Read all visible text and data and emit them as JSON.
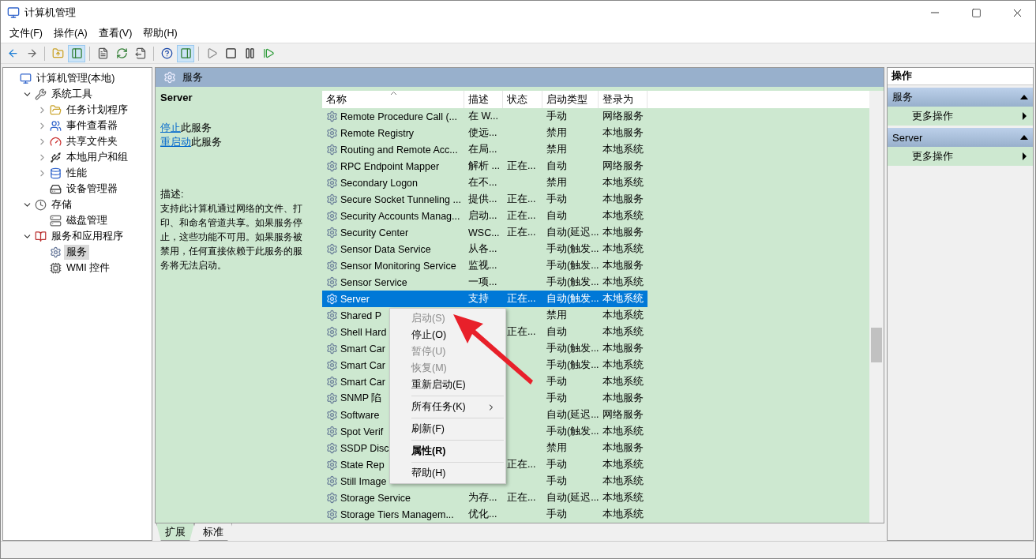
{
  "window": {
    "title": "计算机管理"
  },
  "menu_bar": [
    "文件(F)",
    "操作(A)",
    "查看(V)",
    "帮助(H)"
  ],
  "toolbar": [
    {
      "pressed": false
    },
    {
      "pressed": false
    },
    {
      "pressed": false
    },
    {
      "pressed": true
    },
    {
      "pressed": false
    },
    {
      "pressed": false
    },
    {
      "pressed": false
    },
    {
      "pressed": false
    },
    {
      "pressed": true
    },
    {
      "pressed": false
    },
    {
      "pressed": false
    },
    {
      "pressed": false
    },
    {
      "pressed": false
    }
  ],
  "tree": [
    {
      "label": "计算机管理(本地)",
      "selected": false,
      "children": [
        {
          "label": "系统工具",
          "selected": false,
          "expanded": true,
          "children": [
            {
              "label": "任务计划程序",
              "selected": false,
              "expanded": false
            },
            {
              "label": "事件查看器",
              "selected": false,
              "expanded": false
            },
            {
              "label": "共享文件夹",
              "selected": false,
              "expanded": false
            },
            {
              "label": "本地用户和组",
              "selected": false,
              "expanded": false
            },
            {
              "label": "性能",
              "selected": false,
              "expanded": false
            },
            {
              "label": "设备管理器",
              "selected": false
            }
          ]
        },
        {
          "label": "存储",
          "selected": false,
          "expanded": true,
          "children": [
            {
              "label": "磁盘管理",
              "selected": false
            }
          ]
        },
        {
          "label": "服务和应用程序",
          "selected": false,
          "expanded": true,
          "children": [
            {
              "label": "服务",
              "selected": true
            },
            {
              "label": "WMI 控件",
              "selected": false
            }
          ]
        }
      ]
    }
  ],
  "center": {
    "header": "服务",
    "detail": {
      "title": "Server",
      "links": [
        {
          "link": "停止",
          "text": "此服务"
        },
        {
          "link": "重启动",
          "text": "此服务"
        }
      ],
      "description_label": "描述:",
      "description": "支持此计算机通过网络的文件、打印、和命名管道共享。如果服务停止，这些功能不可用。如果服务被禁用，任何直接依赖于此服务的服务将无法启动。"
    },
    "table": {
      "columns": [
        "名称",
        "描述",
        "状态",
        "启动类型",
        "登录为"
      ],
      "rows": [
        {
          "name": "Remote Procedure Call (...",
          "description": "在 W...",
          "startup": "手动",
          "logon": "网络服务",
          "selected": false
        },
        {
          "name": "Remote Registry",
          "description": "使远...",
          "startup": "禁用",
          "logon": "本地服务",
          "selected": false
        },
        {
          "name": "Routing and Remote Acc...",
          "description": "在局...",
          "startup": "禁用",
          "logon": "本地系统",
          "selected": false
        },
        {
          "name": "RPC Endpoint Mapper",
          "description": "解析 ...",
          "status": "正在...",
          "startup": "自动",
          "logon": "网络服务",
          "selected": false
        },
        {
          "name": "Secondary Logon",
          "description": "在不...",
          "startup": "禁用",
          "logon": "本地系统",
          "selected": false
        },
        {
          "name": "Secure Socket Tunneling ...",
          "description": "提供...",
          "status": "正在...",
          "startup": "手动",
          "logon": "本地服务",
          "selected": false
        },
        {
          "name": "Security Accounts Manag...",
          "description": "启动...",
          "status": "正在...",
          "startup": "自动",
          "logon": "本地系统",
          "selected": false
        },
        {
          "name": "Security Center",
          "description": "WSC...",
          "status": "正在...",
          "startup": "自动(延迟...",
          "logon": "本地服务",
          "selected": false
        },
        {
          "name": "Sensor Data Service",
          "description": "从各...",
          "startup": "手动(触发...",
          "logon": "本地系统",
          "selected": false
        },
        {
          "name": "Sensor Monitoring Service",
          "description": "监视...",
          "startup": "手动(触发...",
          "logon": "本地服务",
          "selected": false
        },
        {
          "name": "Sensor Service",
          "description": "一项...",
          "startup": "手动(触发...",
          "logon": "本地系统",
          "selected": false
        },
        {
          "name": "Server",
          "description": "支持",
          "status": "正在...",
          "startup": "自动(触发...",
          "logon": "本地系统",
          "selected": true
        },
        {
          "name": "Shared P",
          "startup": "禁用",
          "logon": "本地系统",
          "selected": false
        },
        {
          "name": "Shell Hard",
          "status": "正在...",
          "startup": "自动",
          "logon": "本地系统",
          "selected": false
        },
        {
          "name": "Smart Car",
          "startup": "手动(触发...",
          "logon": "本地服务",
          "selected": false
        },
        {
          "name": "Smart Car",
          "startup": "手动(触发...",
          "logon": "本地系统",
          "selected": false
        },
        {
          "name": "Smart Car",
          "startup": "手动",
          "logon": "本地系统",
          "selected": false
        },
        {
          "name": "SNMP 陷",
          "startup": "手动",
          "logon": "本地服务",
          "selected": false
        },
        {
          "name": "Software",
          "startup": "自动(延迟...",
          "logon": "网络服务",
          "selected": false
        },
        {
          "name": "Spot Verif",
          "startup": "手动(触发...",
          "logon": "本地系统",
          "selected": false
        },
        {
          "name": "SSDP Disc",
          "startup": "禁用",
          "logon": "本地服务",
          "selected": false
        },
        {
          "name": "State Rep",
          "status": "正在...",
          "startup": "手动",
          "logon": "本地系统",
          "selected": false
        },
        {
          "name": "Still Image",
          "startup": "手动",
          "logon": "本地系统",
          "selected": false
        },
        {
          "name": "Storage Service",
          "description": "为存...",
          "status": "正在...",
          "startup": "自动(延迟...",
          "logon": "本地系统",
          "selected": false
        },
        {
          "name": "Storage Tiers Managem...",
          "description": "优化...",
          "startup": "手动",
          "logon": "本地系统",
          "selected": false
        }
      ]
    },
    "bottom_tabs": [
      {
        "label": "扩展",
        "selected": true
      },
      {
        "label": "标准",
        "selected": false
      }
    ]
  },
  "context_menu": {
    "groups": [
      [
        {
          "label": "启动(S)",
          "disabled": true
        },
        {
          "label": "停止(O)",
          "disabled": false
        },
        {
          "label": "暂停(U)",
          "disabled": true
        },
        {
          "label": "恢复(M)",
          "disabled": true
        },
        {
          "label": "重新启动(E)",
          "disabled": false
        }
      ],
      [
        {
          "label": "所有任务(K)",
          "disabled": false,
          "submenu": true
        }
      ],
      [
        {
          "label": "刷新(F)",
          "disabled": false
        }
      ],
      [
        {
          "label": "属性(R)",
          "disabled": false,
          "default": true
        }
      ],
      [
        {
          "label": "帮助(H)",
          "disabled": false
        }
      ]
    ]
  },
  "actions": {
    "title": "操作",
    "sections": [
      {
        "title": "服务",
        "expanded": true,
        "items": [
          "更多操作"
        ]
      },
      {
        "title": "Server",
        "expanded": true,
        "items": [
          "更多操作"
        ]
      }
    ]
  }
}
